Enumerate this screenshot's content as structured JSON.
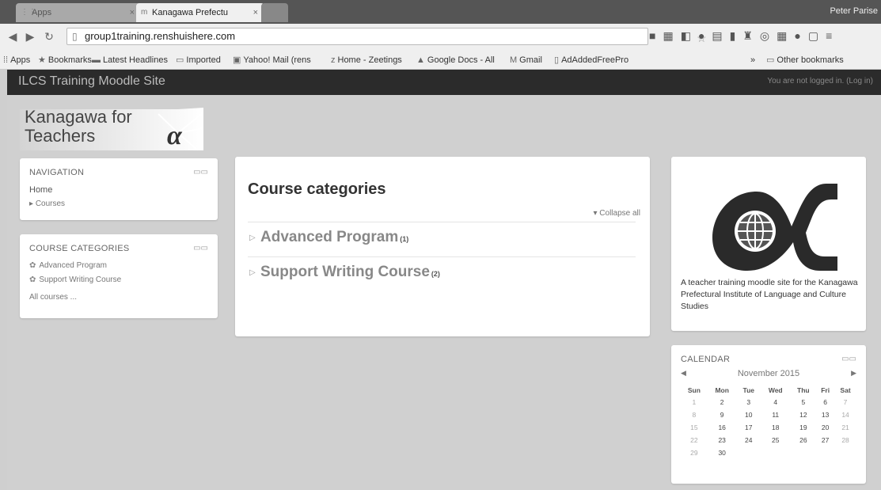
{
  "browser": {
    "tabs": [
      {
        "label": "Apps"
      },
      {
        "label": "Kanagawa Prefectu"
      }
    ],
    "profile_name": "Peter Parise",
    "url": "group1training.renshuishere.com",
    "bookmarks": [
      {
        "label": "Apps",
        "icon": "apps-grid-icon"
      },
      {
        "label": "Bookmarks",
        "icon": "star-icon"
      },
      {
        "label": "Latest Headlines",
        "icon": "rss-icon"
      },
      {
        "label": "Imported",
        "icon": "folder-icon"
      },
      {
        "label": "Yahoo! Mail (rens",
        "icon": "yahoo-icon"
      },
      {
        "label": "Home - Zeetings",
        "icon": "zeetings-icon"
      },
      {
        "label": "Google Docs - All",
        "icon": "drive-icon"
      },
      {
        "label": "Gmail",
        "icon": "gmail-icon"
      },
      {
        "label": "AdAddedFreePro",
        "icon": "page-icon"
      },
      {
        "label": "Other bookmarks",
        "icon": "folder-icon"
      }
    ]
  },
  "header": {
    "site_title": "ILCS Training Moodle Site",
    "login_info": "You are not logged in. (Log in)"
  },
  "logo": {
    "line1": "Kanagawa for",
    "line2": "Teachers"
  },
  "navigation": {
    "title": "NAVIGATION",
    "home": "Home",
    "courses": "Courses"
  },
  "course_categories_block": {
    "title": "COURSE CATEGORIES",
    "items": [
      "Advanced Program",
      "Support Writing Course"
    ],
    "all_courses": "All courses ..."
  },
  "main": {
    "title": "Course categories",
    "collapse_all": "Collapse all",
    "categories": [
      {
        "name": "Advanced Program",
        "count": "(1)"
      },
      {
        "name": "Support Writing Course",
        "count": "(2)"
      }
    ]
  },
  "about": {
    "text": "A teacher training moodle site for the Kanagawa Prefectural Institute of Language and Culture Studies"
  },
  "calendar": {
    "title": "CALENDAR",
    "month": "November 2015",
    "weekdays": [
      "Sun",
      "Mon",
      "Tue",
      "Wed",
      "Thu",
      "Fri",
      "Sat"
    ],
    "weeks": [
      [
        "1",
        "2",
        "3",
        "4",
        "5",
        "6",
        "7"
      ],
      [
        "8",
        "9",
        "10",
        "11",
        "12",
        "13",
        "14"
      ],
      [
        "15",
        "16",
        "17",
        "18",
        "19",
        "20",
        "21"
      ],
      [
        "22",
        "23",
        "24",
        "25",
        "26",
        "27",
        "28"
      ],
      [
        "29",
        "30",
        "",
        "",
        "",
        "",
        ""
      ]
    ]
  }
}
